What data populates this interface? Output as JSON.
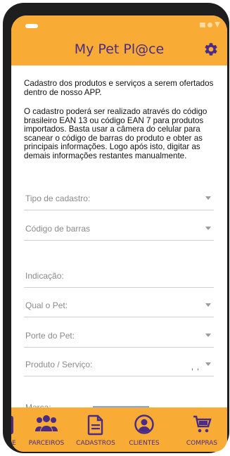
{
  "app": {
    "title": "My Pet Pl@ce"
  },
  "intro": {
    "paragraph1": "Cadastro dos produtos e serviços a serem ofertados dentro de nosso APP.",
    "paragraph2": "O cadastro poderá ser realizado através do código brasileiro EAN 13 ou código EAN 7 para produtos importados. Basta usar a câmera do celular para scanear o código de barras do produto e obter as principais informações. Logo após isto, digitar as demais informações restantes manualmente."
  },
  "form": {
    "tipo_cadastro": "Tipo de cadastro:",
    "codigo_barras": "Código de barras",
    "indicacao": "Indicação:",
    "qual_pet": "Qual o Pet:",
    "porte_pet": "Porte do Pet:",
    "produto_servico": "Produto / Serviço:",
    "produto_servico_value": ", ,",
    "marca": "Marca:"
  },
  "bottom_nav": {
    "items": [
      {
        "label": "CLUBE",
        "icon": "card-icon"
      },
      {
        "label": "PARCEIROS",
        "icon": "group-icon"
      },
      {
        "label": "CADASTROS",
        "icon": "document-icon"
      },
      {
        "label": "CLIENTES",
        "icon": "account-circle-icon"
      },
      {
        "label": "COMPRAS",
        "icon": "cart-icon"
      }
    ]
  },
  "colors": {
    "accent": "#f9ac35",
    "brand_purple": "#4a2c86"
  }
}
